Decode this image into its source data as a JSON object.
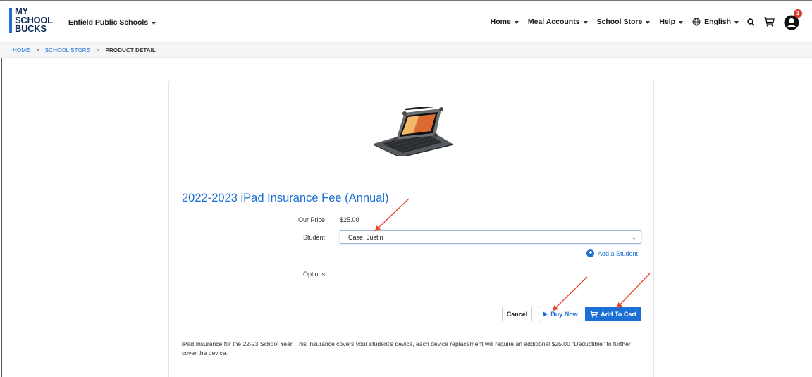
{
  "header": {
    "logo_lines": [
      "MY",
      "SCHOOL",
      "BUCKS"
    ],
    "district": "Enfield Public Schools",
    "nav": [
      {
        "label": "Home"
      },
      {
        "label": "Meal Accounts"
      },
      {
        "label": "School Store"
      },
      {
        "label": "Help"
      }
    ],
    "language": "English",
    "notification_count": "1",
    "icons": [
      "globe-icon",
      "search-icon",
      "cart-icon",
      "user-avatar-icon"
    ]
  },
  "breadcrumb": {
    "items": [
      "HOME",
      "SCHOOL STORE"
    ],
    "separator": ">",
    "current": "PRODUCT DETAIL"
  },
  "product": {
    "title": "2022-2023 iPad Insurance Fee (Annual)",
    "price_label": "Our Price",
    "price": "$25.00",
    "student_label": "Student",
    "student_selected": "Case, Justin",
    "add_student": "Add a Student",
    "options_label": "Options",
    "description": "iPad Insurance for the 22-23 School Year. This insurance covers your student's device, each device replacement will require an additional $25.00 \"Deductible\" to further cover the device."
  },
  "actions": {
    "cancel": "Cancel",
    "buy_now": "Buy Now",
    "add_to_cart": "Add To Cart"
  },
  "colors": {
    "brand_blue": "#1c6fd4",
    "logo_navy": "#0e2a56",
    "annotation_red": "#e8452b",
    "badge_red": "#d9382e"
  }
}
